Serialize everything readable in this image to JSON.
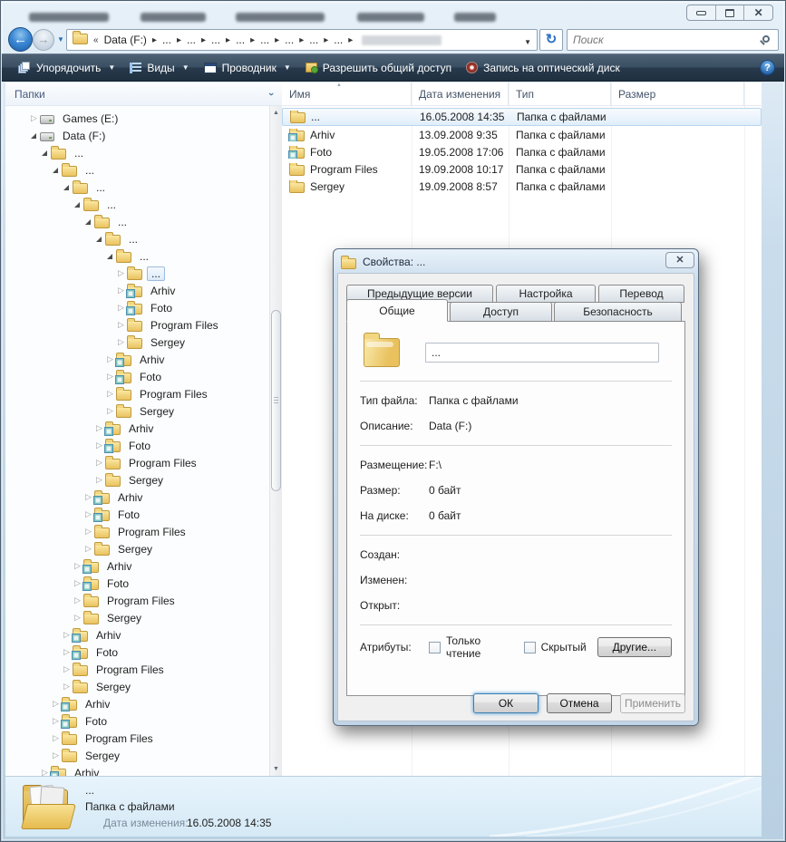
{
  "window": {
    "search_placeholder": "Поиск",
    "breadcrumb": {
      "chevron": "«",
      "root": "Data (F:)",
      "crumbs": [
        "...",
        "...",
        "...",
        "...",
        "...",
        "...",
        "...",
        "..."
      ]
    }
  },
  "toolbar": {
    "items": [
      {
        "label": "Упорядочить",
        "icon": "organize-icon",
        "dropdown": true
      },
      {
        "label": "Виды",
        "icon": "views-icon",
        "dropdown": true
      },
      {
        "label": "Проводник",
        "icon": "explorer-icon",
        "dropdown": true
      },
      {
        "label": "Разрешить общий доступ",
        "icon": "share-icon",
        "dropdown": false
      },
      {
        "label": "Запись на оптический диск",
        "icon": "burn-icon",
        "dropdown": false
      }
    ]
  },
  "tree": {
    "header": "Папки",
    "items": [
      {
        "level": 1,
        "arrow": "col",
        "icon": "drive",
        "label": "Games (E:)"
      },
      {
        "level": 1,
        "arrow": "exp",
        "icon": "drive",
        "label": "Data (F:)"
      },
      {
        "level": 2,
        "arrow": "exp",
        "icon": "folder",
        "label": "..."
      },
      {
        "level": 3,
        "arrow": "exp",
        "icon": "folder",
        "label": "..."
      },
      {
        "level": 4,
        "arrow": "exp",
        "icon": "folder",
        "label": "..."
      },
      {
        "level": 5,
        "arrow": "exp",
        "icon": "folder",
        "label": "..."
      },
      {
        "level": 6,
        "arrow": "exp",
        "icon": "folder",
        "label": "..."
      },
      {
        "level": 7,
        "arrow": "exp",
        "icon": "folder",
        "label": "..."
      },
      {
        "level": 8,
        "arrow": "exp",
        "icon": "folder",
        "label": "..."
      },
      {
        "level": 9,
        "arrow": "col",
        "icon": "folder",
        "label": "...",
        "selected": true
      },
      {
        "level": 9,
        "arrow": "col",
        "icon": "folder-badge",
        "label": "Arhiv"
      },
      {
        "level": 9,
        "arrow": "col",
        "icon": "folder-badge",
        "label": "Foto"
      },
      {
        "level": 9,
        "arrow": "col",
        "icon": "folder",
        "label": "Program Files"
      },
      {
        "level": 9,
        "arrow": "col",
        "icon": "folder",
        "label": "Sergey"
      },
      {
        "level": 8,
        "arrow": "col",
        "icon": "folder-badge",
        "label": "Arhiv"
      },
      {
        "level": 8,
        "arrow": "col",
        "icon": "folder-badge",
        "label": "Foto"
      },
      {
        "level": 8,
        "arrow": "col",
        "icon": "folder",
        "label": "Program Files"
      },
      {
        "level": 8,
        "arrow": "col",
        "icon": "folder",
        "label": "Sergey"
      },
      {
        "level": 7,
        "arrow": "col",
        "icon": "folder-badge",
        "label": "Arhiv"
      },
      {
        "level": 7,
        "arrow": "col",
        "icon": "folder-badge",
        "label": "Foto"
      },
      {
        "level": 7,
        "arrow": "col",
        "icon": "folder",
        "label": "Program Files"
      },
      {
        "level": 7,
        "arrow": "col",
        "icon": "folder",
        "label": "Sergey"
      },
      {
        "level": 6,
        "arrow": "col",
        "icon": "folder-badge",
        "label": "Arhiv"
      },
      {
        "level": 6,
        "arrow": "col",
        "icon": "folder-badge",
        "label": "Foto"
      },
      {
        "level": 6,
        "arrow": "col",
        "icon": "folder",
        "label": "Program Files"
      },
      {
        "level": 6,
        "arrow": "col",
        "icon": "folder",
        "label": "Sergey"
      },
      {
        "level": 5,
        "arrow": "col",
        "icon": "folder-badge",
        "label": "Arhiv"
      },
      {
        "level": 5,
        "arrow": "col",
        "icon": "folder-badge",
        "label": "Foto"
      },
      {
        "level": 5,
        "arrow": "col",
        "icon": "folder",
        "label": "Program Files"
      },
      {
        "level": 5,
        "arrow": "col",
        "icon": "folder",
        "label": "Sergey"
      },
      {
        "level": 4,
        "arrow": "col",
        "icon": "folder-badge",
        "label": "Arhiv"
      },
      {
        "level": 4,
        "arrow": "col",
        "icon": "folder-badge",
        "label": "Foto"
      },
      {
        "level": 4,
        "arrow": "col",
        "icon": "folder",
        "label": "Program Files"
      },
      {
        "level": 4,
        "arrow": "col",
        "icon": "folder",
        "label": "Sergey"
      },
      {
        "level": 3,
        "arrow": "col",
        "icon": "folder-badge",
        "label": "Arhiv"
      },
      {
        "level": 3,
        "arrow": "col",
        "icon": "folder-badge",
        "label": "Foto"
      },
      {
        "level": 3,
        "arrow": "col",
        "icon": "folder",
        "label": "Program Files"
      },
      {
        "level": 3,
        "arrow": "col",
        "icon": "folder",
        "label": "Sergey"
      },
      {
        "level": 2,
        "arrow": "col",
        "icon": "folder-badge",
        "label": "Arhiv"
      }
    ]
  },
  "list": {
    "columns": [
      "Имя",
      "Дата изменения",
      "Тип",
      "Размер"
    ],
    "rows": [
      {
        "name": "...",
        "date": "16.05.2008 14:35",
        "type": "Папка с файлами",
        "size": "",
        "icon": "folder",
        "selected": true
      },
      {
        "name": "Arhiv",
        "date": "13.09.2008 9:35",
        "type": "Папка с файлами",
        "size": "",
        "icon": "folder-badge",
        "selected": false
      },
      {
        "name": "Foto",
        "date": "19.05.2008 17:06",
        "type": "Папка с файлами",
        "size": "",
        "icon": "folder-badge",
        "selected": false
      },
      {
        "name": "Program Files",
        "date": "19.09.2008 10:17",
        "type": "Папка с файлами",
        "size": "",
        "icon": "folder",
        "selected": false
      },
      {
        "name": "Sergey",
        "date": "19.09.2008 8:57",
        "type": "Папка с файлами",
        "size": "",
        "icon": "folder",
        "selected": false
      }
    ]
  },
  "details": {
    "name": "...",
    "type": "Папка с файлами",
    "date_label": "Дата изменения:",
    "date_value": "16.05.2008 14:35"
  },
  "dialog": {
    "title": "Свойства: ...",
    "tabs_back": [
      "Предыдущие версии",
      "Настройка",
      "Перевод"
    ],
    "tabs_front": [
      "Общие",
      "Доступ",
      "Безопасность"
    ],
    "active_tab": "Общие",
    "name_value": "...",
    "fields": [
      {
        "label": "Тип файла:",
        "value": "Папка с файлами",
        "group": 1
      },
      {
        "label": "Описание:",
        "value": "Data (F:)",
        "group": 1
      },
      {
        "label": "Размещение:",
        "value": "F:\\",
        "group": 2
      },
      {
        "label": "Размер:",
        "value": "0 байт",
        "group": 2
      },
      {
        "label": "На диске:",
        "value": "0 байт",
        "group": 2
      },
      {
        "label": "Создан:",
        "value": "",
        "group": 3
      },
      {
        "label": "Изменен:",
        "value": "",
        "group": 3
      },
      {
        "label": "Открыт:",
        "value": "",
        "group": 3
      }
    ],
    "attributes_label": "Атрибуты:",
    "checkbox_readonly": "Только чтение",
    "checkbox_hidden": "Скрытый",
    "more_button": "Другие...",
    "ok": "ОК",
    "cancel": "Отмена",
    "apply": "Применить"
  }
}
